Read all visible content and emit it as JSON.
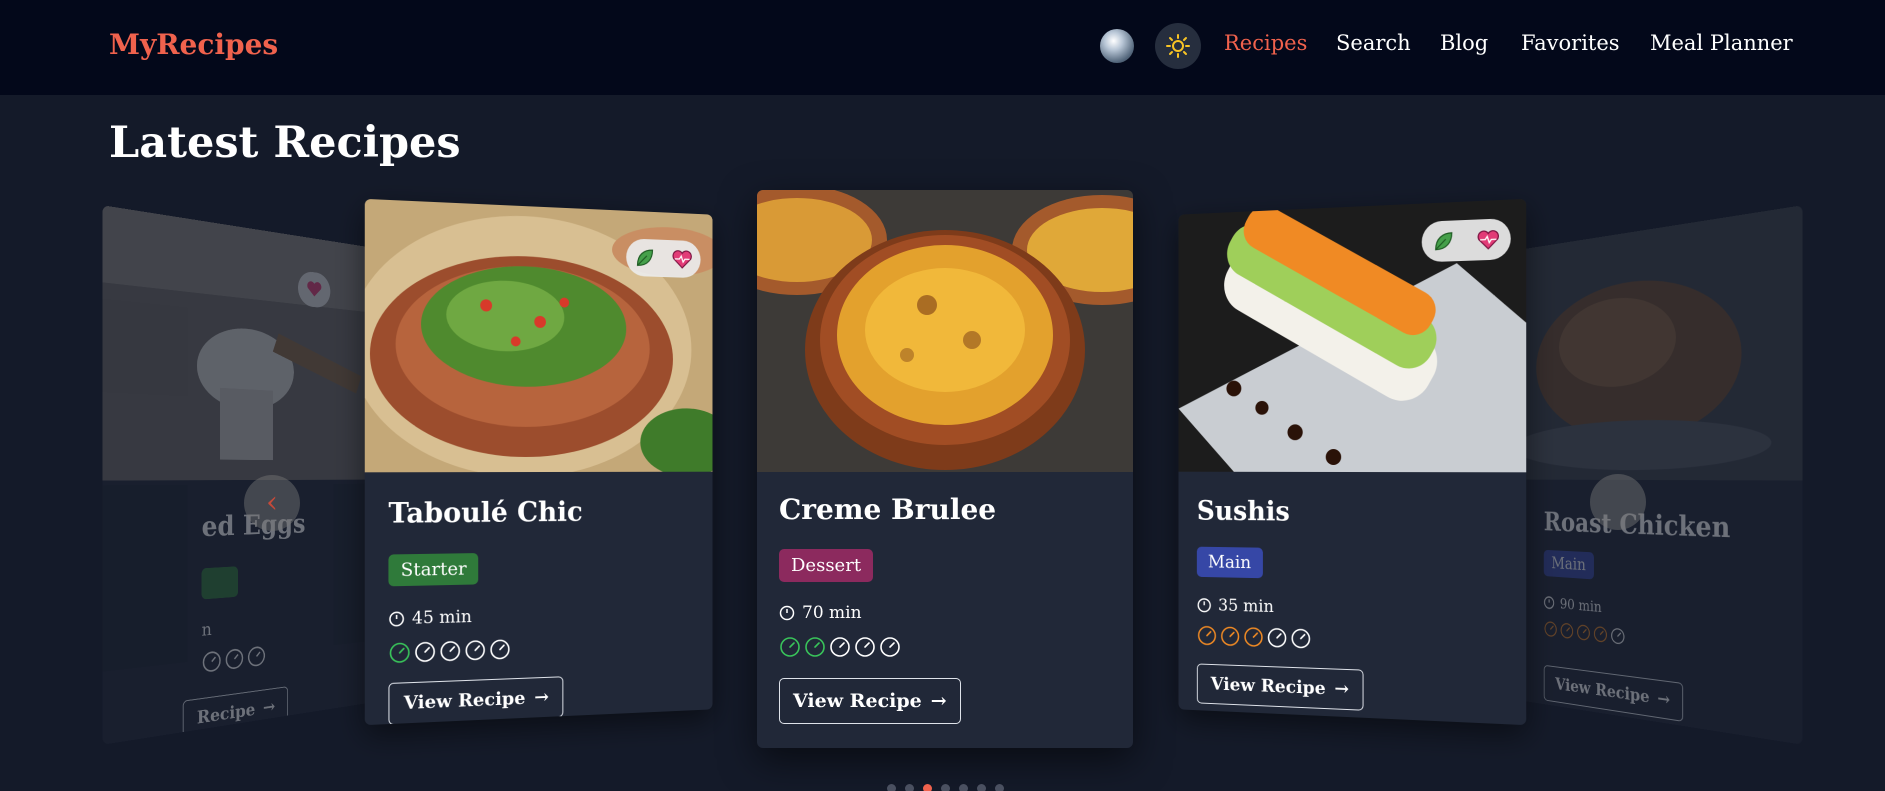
{
  "nav": {
    "brand": "MyRecipes",
    "links": [
      "Recipes",
      "Search",
      "Blog",
      "Favorites",
      "Meal Planner"
    ],
    "active": "Recipes",
    "theme_icon": "sun-icon",
    "avatar_icon": "user-avatar"
  },
  "section": {
    "title": "Latest Recipes"
  },
  "colors": {
    "accent": "#f0624d",
    "starter": "#2f7a3a",
    "dessert": "#8c2a5e",
    "main": "#3647a6",
    "difficulty_green": "#39c35a",
    "difficulty_orange": "#f08a24"
  },
  "recipes": [
    {
      "title": "ed Eggs",
      "category": "",
      "time": "",
      "difficulty_filled": 0,
      "difficulty_total": 5,
      "button": "Recipe",
      "partial": true
    },
    {
      "title": "Taboulé Chic",
      "category": "Starter",
      "time": "45 min",
      "difficulty_filled": 1,
      "difficulty_total": 5,
      "button": "View Recipe",
      "icons": [
        "leaf-icon",
        "heart-pulse-icon"
      ]
    },
    {
      "title": "Creme Brulee",
      "category": "Dessert",
      "time": "70 min",
      "difficulty_filled": 2,
      "difficulty_total": 5,
      "button": "View Recipe"
    },
    {
      "title": "Sushis",
      "category": "Main",
      "time": "35 min",
      "difficulty_filled": 3,
      "difficulty_total": 5,
      "button": "View Recipe",
      "icons": [
        "leaf-icon",
        "heart-pulse-icon"
      ]
    },
    {
      "title": "Roast Chicken",
      "category": "Main",
      "time": "90 min",
      "difficulty_filled": 4,
      "difficulty_total": 5,
      "button": "View Recipe",
      "partial": true
    }
  ],
  "carousel": {
    "dot_count": 7,
    "active_dot": 2
  }
}
